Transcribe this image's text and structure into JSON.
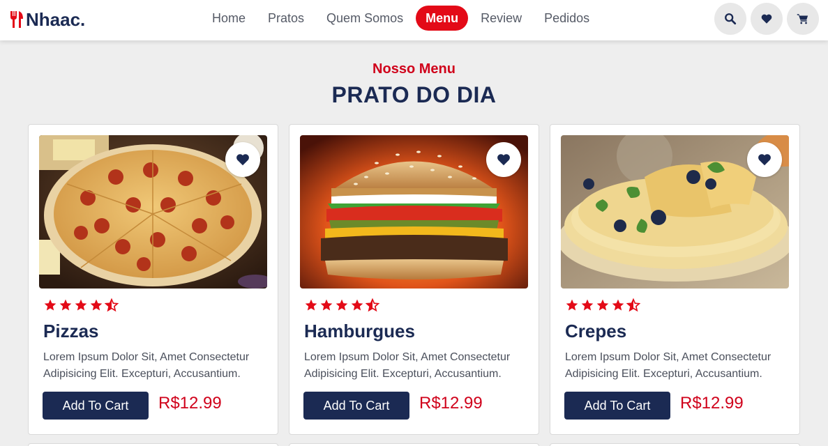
{
  "brand": {
    "name": "Nhaac.",
    "logo_icon": "fork-knife-icon"
  },
  "nav": {
    "items": [
      {
        "label": "Home",
        "active": false
      },
      {
        "label": "Pratos",
        "active": false
      },
      {
        "label": "Quem Somos",
        "active": false
      },
      {
        "label": "Menu",
        "active": true
      },
      {
        "label": "Review",
        "active": false
      },
      {
        "label": "Pedidos",
        "active": false
      }
    ]
  },
  "header_actions": [
    {
      "icon": "search-icon"
    },
    {
      "icon": "heart-icon"
    },
    {
      "icon": "cart-icon"
    }
  ],
  "section": {
    "subtitle": "Nosso Menu",
    "title": "PRATO DO DIA"
  },
  "cards": [
    {
      "name": "Pizzas",
      "image": "pizza",
      "rating": 4.5,
      "description": "Lorem Ipsum Dolor Sit, Amet Consectetur Adipisicing Elit. Excepturi, Accusantium.",
      "button": "Add To Cart",
      "price": "R$12.99"
    },
    {
      "name": "Hamburgues",
      "image": "burger",
      "rating": 4.5,
      "description": "Lorem Ipsum Dolor Sit, Amet Consectetur Adipisicing Elit. Excepturi, Accusantium.",
      "button": "Add To Cart",
      "price": "R$12.99"
    },
    {
      "name": "Crepes",
      "image": "crepes",
      "rating": 4.5,
      "description": "Lorem Ipsum Dolor Sit, Amet Consectetur Adipisicing Elit. Excepturi, Accusantium.",
      "button": "Add To Cart",
      "price": "R$12.99"
    }
  ],
  "colors": {
    "brand_navy": "#1b2a53",
    "accent_red": "#e30a17",
    "price_red": "#d0021b",
    "background": "#eeeeee"
  }
}
